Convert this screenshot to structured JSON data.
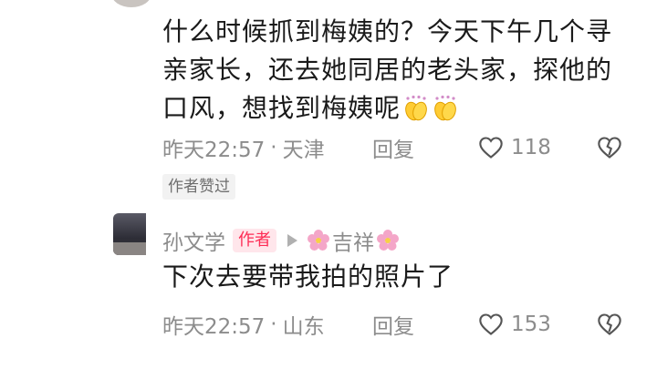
{
  "comment1": {
    "text_lines": [
      "什么时候抓到梅姨的？今天下午几个寻",
      "亲家长，还去她同居的老头家，探他的",
      "口风，想找到梅姨呢"
    ],
    "emoji": [
      "clap-icon",
      "clap-icon"
    ],
    "time": "昨天22:57",
    "location": "天津",
    "reply_label": "回复",
    "like_count": "118",
    "author_liked": "作者赞过"
  },
  "comment2": {
    "user_name": "孙文学",
    "author_badge": "作者",
    "reply_to": "吉祥",
    "text": "下次去要带我拍的照片了",
    "time": "昨天22:57",
    "location": "山东",
    "reply_label": "回复",
    "like_count": "153"
  },
  "separator_dot": "·",
  "colors": {
    "text": "#1a1a1a",
    "meta": "#8c8c8c",
    "author_badge_text": "#fe2c55",
    "author_badge_bg": "#ffe6eb"
  }
}
